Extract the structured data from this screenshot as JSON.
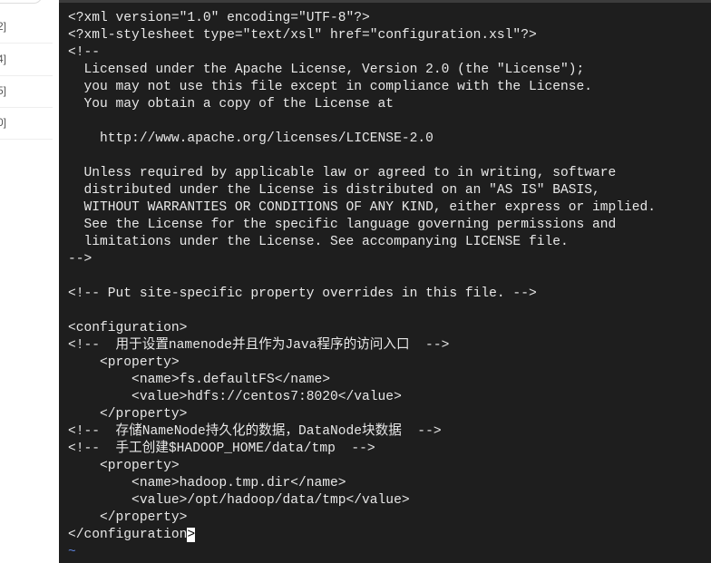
{
  "sidebar": {
    "items": [
      "2]",
      "4]",
      "5]",
      "0]"
    ]
  },
  "editor": {
    "lines": [
      "<?xml version=\"1.0\" encoding=\"UTF-8\"?>",
      "<?xml-stylesheet type=\"text/xsl\" href=\"configuration.xsl\"?>",
      "<!--",
      "  Licensed under the Apache License, Version 2.0 (the \"License\");",
      "  you may not use this file except in compliance with the License.",
      "  You may obtain a copy of the License at",
      "",
      "    http://www.apache.org/licenses/LICENSE-2.0",
      "",
      "  Unless required by applicable law or agreed to in writing, software",
      "  distributed under the License is distributed on an \"AS IS\" BASIS,",
      "  WITHOUT WARRANTIES OR CONDITIONS OF ANY KIND, either express or implied.",
      "  See the License for the specific language governing permissions and",
      "  limitations under the License. See accompanying LICENSE file.",
      "-->",
      "",
      "<!-- Put site-specific property overrides in this file. -->",
      "",
      "<configuration>",
      "<!--  用于设置namenode并且作为Java程序的访问入口  -->",
      "    <property>",
      "        <name>fs.defaultFS</name>",
      "        <value>hdfs://centos7:8020</value>",
      "    </property>",
      "<!--  存储NameNode持久化的数据，DataNode块数据  -->",
      "<!--  手工创建$HADOOP_HOME/data/tmp  -->",
      "    <property>",
      "        <name>hadoop.tmp.dir</name>",
      "        <value>/opt/hadoop/data/tmp</value>",
      "    </property>"
    ],
    "last_line": "</configuration",
    "cursor_char": ">",
    "tilde": "~"
  },
  "colors": {
    "background": "#1e1e1e",
    "text": "#e8e8e8",
    "tilde": "#5b7fd6"
  }
}
